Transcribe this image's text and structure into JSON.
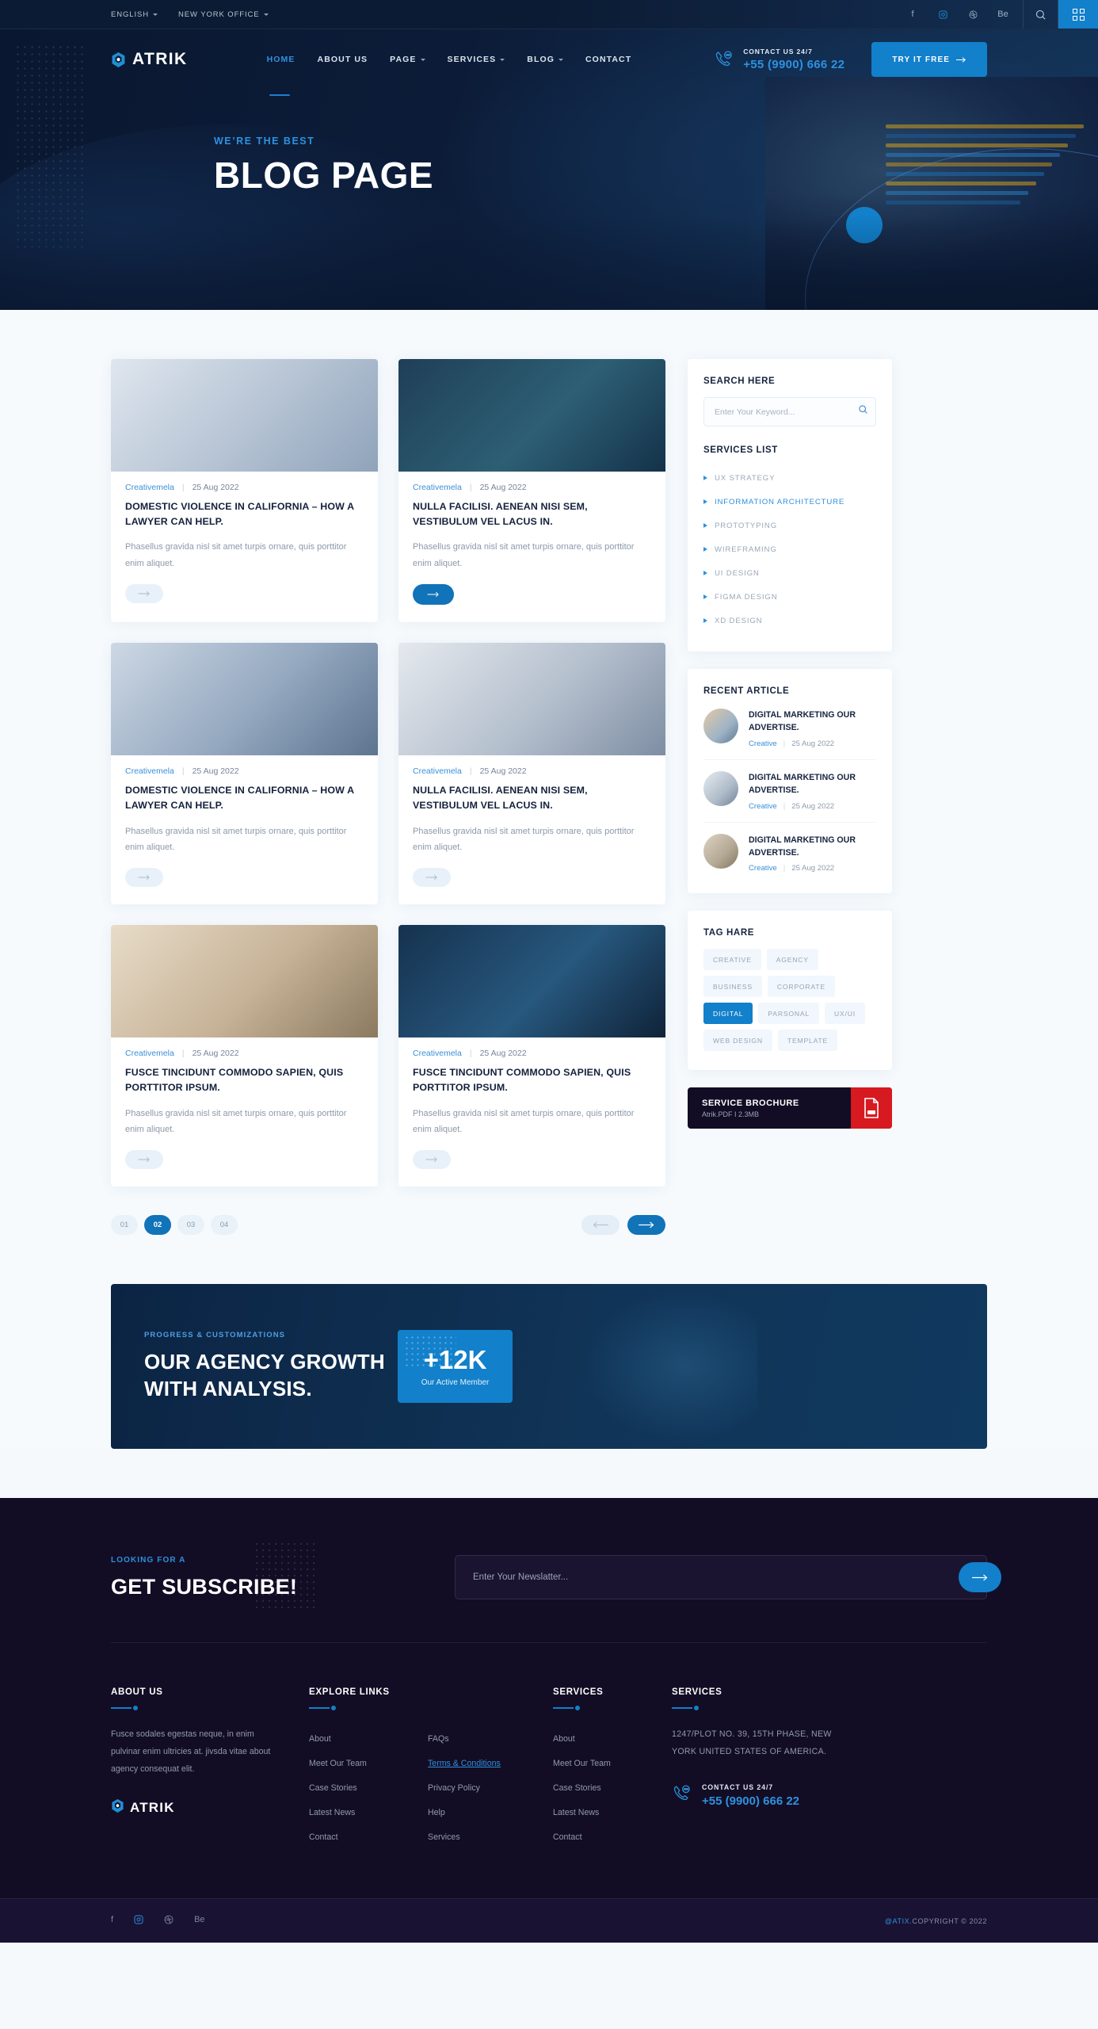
{
  "topbar": {
    "language": "ENGLISH",
    "office": "NEW YORK OFFICE",
    "socials": [
      "facebook-icon",
      "instagram-icon",
      "dribbble-icon",
      "behance-icon"
    ],
    "social_glyphs": [
      "f",
      "□",
      "●",
      "Be"
    ]
  },
  "header": {
    "brand": "ATRIK",
    "menu": [
      {
        "label": "HOME",
        "active": true,
        "caret": false
      },
      {
        "label": "ABOUT US",
        "active": false,
        "caret": false
      },
      {
        "label": "PAGE",
        "active": false,
        "caret": true
      },
      {
        "label": "SERVICES",
        "active": false,
        "caret": true
      },
      {
        "label": "BLOG",
        "active": false,
        "caret": true
      },
      {
        "label": "CONTACT",
        "active": false,
        "caret": false
      }
    ],
    "contact_label": "CONTACT US 24/7",
    "contact_number": "+55 (9900) 666 22",
    "cta_button": "TRY IT FREE"
  },
  "hero": {
    "subtitle": "WE’RE THE BEST",
    "title": "BLOG PAGE"
  },
  "posts": [
    {
      "author": "Creativemela",
      "date": "25 Aug 2022",
      "title": "DOMESTIC VIOLENCE IN CALIFORNIA – HOW A LAWYER CAN HELP.",
      "excerpt": "Phasellus gravida nisl sit amet turpis ornare, quis porttitor enim aliquet.",
      "highlight": false
    },
    {
      "author": "Creativemela",
      "date": "25 Aug 2022",
      "title": "NULLA FACILISI. AENEAN NISI SEM, VESTIBULUM VEL LACUS IN.",
      "excerpt": "Phasellus gravida nisl sit amet turpis ornare, quis porttitor enim aliquet.",
      "highlight": true
    },
    {
      "author": "Creativemela",
      "date": "25 Aug 2022",
      "title": "DOMESTIC VIOLENCE IN CALIFORNIA – HOW A LAWYER CAN HELP.",
      "excerpt": "Phasellus gravida nisl sit amet turpis ornare, quis porttitor enim aliquet.",
      "highlight": false
    },
    {
      "author": "Creativemela",
      "date": "25 Aug 2022",
      "title": "NULLA FACILISI. AENEAN NISI SEM, VESTIBULUM VEL LACUS IN.",
      "excerpt": "Phasellus gravida nisl sit amet turpis ornare, quis porttitor enim aliquet.",
      "highlight": false
    },
    {
      "author": "Creativemela",
      "date": "25 Aug 2022",
      "title": "FUSCE TINCIDUNT COMMODO SAPIEN, QUIS PORTTITOR IPSUM.",
      "excerpt": "Phasellus gravida nisl sit amet turpis ornare, quis porttitor enim aliquet.",
      "highlight": false
    },
    {
      "author": "Creativemela",
      "date": "25 Aug 2022",
      "title": "FUSCE TINCIDUNT COMMODO SAPIEN, QUIS PORTTITOR IPSUM.",
      "excerpt": "Phasellus gravida nisl sit amet turpis ornare, quis porttitor enim aliquet.",
      "highlight": false
    }
  ],
  "sidebar": {
    "search": {
      "title": "SEARCH HERE",
      "placeholder": "Enter Your Keyword..."
    },
    "services": {
      "title": "SERVICES LIST",
      "items": [
        {
          "label": "UX STRATEGY",
          "active": false
        },
        {
          "label": "INFORMATION ARCHITECTURE",
          "active": true
        },
        {
          "label": "PROTOTYPING",
          "active": false
        },
        {
          "label": "WIREFRAMING",
          "active": false
        },
        {
          "label": "UI DESIGN",
          "active": false
        },
        {
          "label": "FIGMA DESIGN",
          "active": false
        },
        {
          "label": "XD DESIGN",
          "active": false
        }
      ]
    },
    "recent": {
      "title": "RECENT ARTICLE",
      "items": [
        {
          "title": "DIGITAL MARKETING OUR ADVERTISE.",
          "category": "Creative",
          "date": "25 Aug 2022"
        },
        {
          "title": "DIGITAL MARKETING OUR ADVERTISE.",
          "category": "Creative",
          "date": "25 Aug 2022"
        },
        {
          "title": "DIGITAL MARKETING OUR ADVERTISE.",
          "category": "Creative",
          "date": "25 Aug 2022"
        }
      ]
    },
    "tags": {
      "title": "TAG HARE",
      "items": [
        {
          "label": "CREATIVE",
          "active": false
        },
        {
          "label": "AGENCY",
          "active": false
        },
        {
          "label": "BUSINESS",
          "active": false
        },
        {
          "label": "CORPORATE",
          "active": false
        },
        {
          "label": "DIGITAL",
          "active": true
        },
        {
          "label": "PARSONAL",
          "active": false
        },
        {
          "label": "UX/UI",
          "active": false
        },
        {
          "label": "WEB DESIGN",
          "active": false
        },
        {
          "label": "TEMPLATE",
          "active": false
        }
      ]
    },
    "brochure": {
      "title": "SERVICE BROCHURE",
      "meta": "Atrik.PDF  I  2.3MB",
      "icon": "pdf-file-icon"
    }
  },
  "pagination": {
    "pages": [
      {
        "label": "01",
        "active": false
      },
      {
        "label": "02",
        "active": true
      },
      {
        "label": "03",
        "active": false
      },
      {
        "label": "04",
        "active": false
      }
    ],
    "prev": "prev-arrow-icon",
    "next": "next-arrow-icon"
  },
  "cta": {
    "subtitle": "PROGRESS & CUSTOMIZATIONS",
    "title_line1": "OUR AGENCY GROWTH",
    "title_line2": "WITH ANALYSIS.",
    "stat_value": "+12K",
    "stat_label": "Our Active Member"
  },
  "subscribe": {
    "eyebrow": "LOOKING FOR A",
    "title": "GET SUBSCRIBE!",
    "placeholder": "Enter Your Newslatter...",
    "submit": "subscribe-arrow-icon"
  },
  "footer": {
    "about": {
      "heading": "ABOUT US",
      "text": "Fusce sodales egestas neque, in enim pulvinar enim ultricies at. jivsda vitae about agency  consequat elit.",
      "brand": "ATRIK"
    },
    "explore": {
      "heading": "EXPLORE LINKS",
      "links": [
        "About",
        "Meet Our Team",
        "Case Stories",
        "Latest News",
        "Contact"
      ]
    },
    "explore2": {
      "links": [
        {
          "label": "FAQs",
          "highlight": false
        },
        {
          "label": "Terms & Conditions",
          "highlight": true
        },
        {
          "label": "Privacy Policy",
          "highlight": false
        },
        {
          "label": "Help",
          "highlight": false
        },
        {
          "label": "Services",
          "highlight": false
        }
      ]
    },
    "services": {
      "heading": "SERVICES",
      "links": [
        "About",
        "Meet Our Team",
        "Case Stories",
        "Latest News",
        "Contact"
      ]
    },
    "contact": {
      "heading": "SERVICES",
      "address": "1247/PLOT NO. 39, 15TH PHASE, NEW YORK UNITED STATES OF AMERICA.",
      "label": "CONTACT US 24/7",
      "number": "+55 (9900) 666 22"
    },
    "bottom": {
      "socials": [
        "f",
        "□",
        "●",
        "Be"
      ],
      "copyright_brand": "@ATIX.",
      "copyright": "COPYRIGHT © 2022"
    }
  },
  "colors": {
    "accent": "#1280cb",
    "accent_light": "#2e91e0",
    "dark": "#0b1b33",
    "footer": "#120d24",
    "red": "#d71920"
  }
}
